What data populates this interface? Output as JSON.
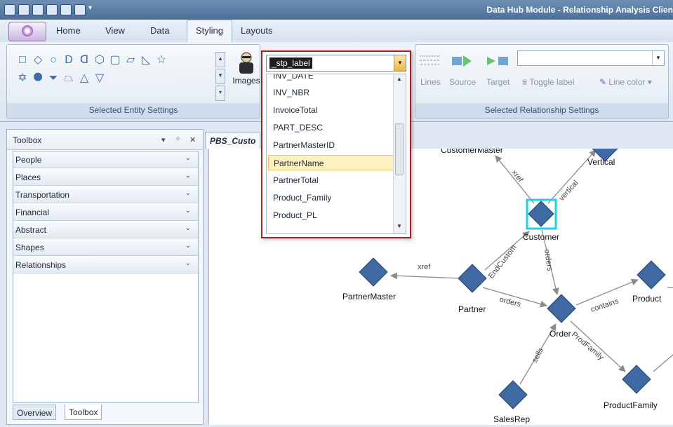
{
  "app": {
    "title": "Data Hub Module - Relationship Analysis Clien"
  },
  "tabs": [
    {
      "label": "Home"
    },
    {
      "label": "View"
    },
    {
      "label": "Data"
    },
    {
      "label": "Styling",
      "active": true
    },
    {
      "label": "Layouts"
    }
  ],
  "ribbon": {
    "entity_group_label": "Selected Entity Settings",
    "images_label": "Images",
    "relationship_group_label": "Selected Relationship Settings",
    "lines_label": "Lines",
    "source_label": "Source",
    "target_label": "Target",
    "toggle_label": "Toggle label",
    "line_color_label": "Line color",
    "shapes": [
      "square",
      "diamond",
      "circle",
      "delay",
      "stored-data",
      "hexagon",
      "rounded-rect",
      "parallelogram",
      "manual-input",
      "star",
      "star6",
      "octagon",
      "triangle-down-trap",
      "trapezoid",
      "triangle-up",
      "triangle-down"
    ]
  },
  "label_combo": {
    "value": "_stp_label",
    "options": [
      "INV_DATE",
      "INV_NBR",
      "InvoiceTotal",
      "PART_DESC",
      "PartnerMasterID",
      "PartnerName",
      "PartnerTotal",
      "Product_Family",
      "Product_PL"
    ],
    "highlighted": "PartnerName"
  },
  "toolbox": {
    "title": "Toolbox",
    "categories": [
      "People",
      "Places",
      "Transportation",
      "Financial",
      "Abstract",
      "Shapes",
      "Relationships"
    ],
    "bottom_tabs": [
      "Overview",
      "Toolbox"
    ],
    "active_bottom_tab": "Toolbox"
  },
  "document": {
    "tab_label": "PBS_Custo"
  },
  "graph": {
    "nodes": [
      "CustomerMaster",
      "Vertical",
      "Customer",
      "PartnerMaster",
      "Partner",
      "Order",
      "Product",
      "ProductFamily",
      "SalesRep"
    ],
    "edges": [
      {
        "from": "Customer",
        "to": "CustomerMaster",
        "label": "xref"
      },
      {
        "from": "Customer",
        "to": "Vertical",
        "label": "vertical"
      },
      {
        "from": "Customer",
        "to": "Order",
        "label": "orders"
      },
      {
        "from": "Partner",
        "to": "Customer",
        "label": "EndCustom"
      },
      {
        "from": "Partner",
        "to": "PartnerMaster",
        "label": "xref"
      },
      {
        "from": "Partner",
        "to": "Order",
        "label": "orders"
      },
      {
        "from": "Order",
        "to": "Product",
        "label": "contains"
      },
      {
        "from": "Order",
        "to": "ProductFamily",
        "label": "ProdFamily"
      },
      {
        "from": "SalesRep",
        "to": "Order",
        "label": "sells"
      }
    ],
    "selected_node": "Customer",
    "colors": {
      "node": "#3f6aa4",
      "selection": "#19d3e6",
      "edge": "#8c8c8c"
    }
  }
}
